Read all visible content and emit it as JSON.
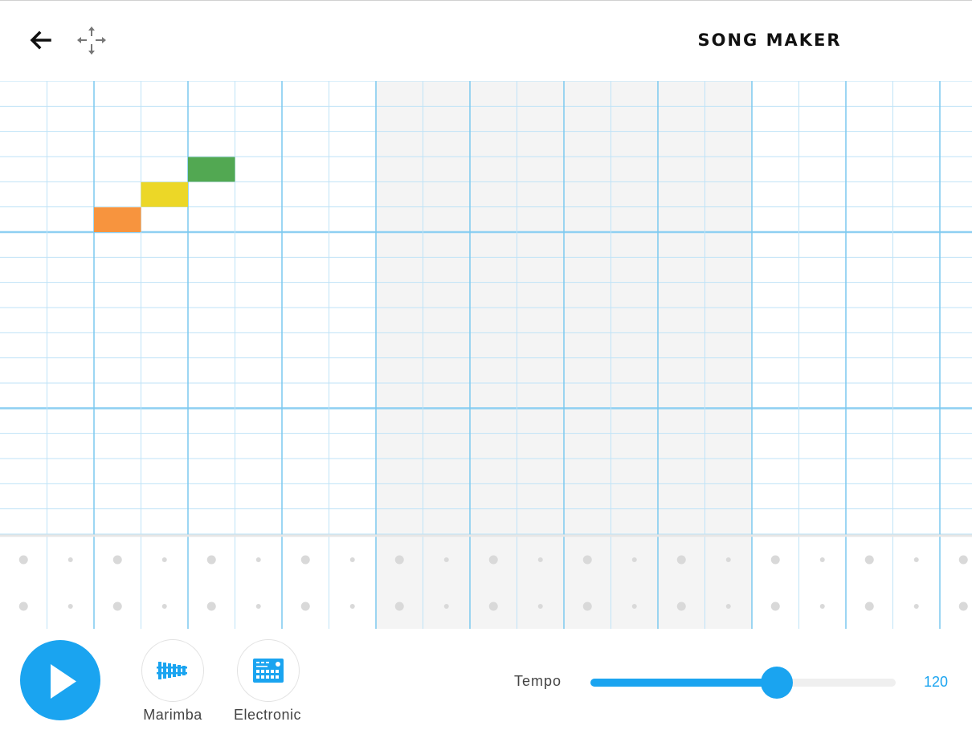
{
  "header": {
    "title": "SONG MAKER",
    "back_icon": "arrow-left-icon",
    "move_icon": "move-arrows-icon"
  },
  "grid": {
    "columns": 21,
    "rows": 18,
    "shaded_columns": [
      8,
      9,
      10,
      11,
      12,
      13,
      14,
      15
    ],
    "notes": [
      {
        "col": 2,
        "row": 5,
        "color": "#f7943e"
      },
      {
        "col": 3,
        "row": 4,
        "color": "#ecd727"
      },
      {
        "col": 4,
        "row": 3,
        "color": "#52a852"
      }
    ]
  },
  "percussion": {
    "rows": 2
  },
  "controls": {
    "play_icon": "play-icon",
    "instruments": [
      {
        "label": "Marimba",
        "icon": "marimba-icon"
      },
      {
        "label": "Electronic",
        "icon": "electronic-drum-icon"
      }
    ],
    "tempo": {
      "label": "Tempo",
      "value": "120",
      "level": 0.61
    }
  },
  "colors": {
    "accent": "#1aa4f0",
    "grid_line": "#bfe3f7",
    "grid_line_strong": "#8fd0f2",
    "shade": "#f4f4f4",
    "dot": "#d9d9d9"
  }
}
